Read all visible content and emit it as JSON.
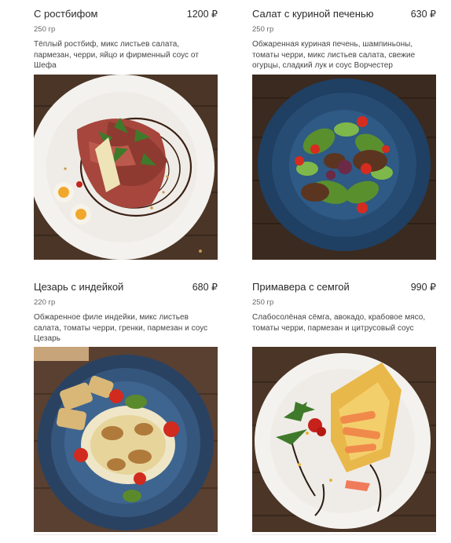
{
  "menu": {
    "items": [
      {
        "title": "С ростбифом",
        "price": "1200 ₽",
        "weight": "250 гр",
        "description": "Тёплый ростбиф, микс листьев салата, пармезан, черри, яйцо и фирменный соус от Шефа",
        "photo": "salad-roastbeef-photo"
      },
      {
        "title": "Салат с куриной печенью",
        "price": "630 ₽",
        "weight": "250 гр",
        "description": "Обжаренная куриная печень, шампиньоны, томаты черри, микс листьев салата, свежие огурцы, сладкий лук и соус Ворчестер",
        "photo": "salad-chicken-liver-photo"
      },
      {
        "title": "Цезарь с индейкой",
        "price": "680 ₽",
        "weight": "220 гр",
        "description": "Обжаренное филе индейки, микс листьев салата, томаты черри, гренки, пармезан и соус Цезарь",
        "photo": "caesar-turkey-photo"
      },
      {
        "title": "Примавера с семгой",
        "price": "990 ₽",
        "weight": "250 гр",
        "description": "Слабосолёная сёмга, авокадо, крабовое мясо, томаты черри, пармезан и цитрусовый соус",
        "photo": "primavera-salmon-photo"
      }
    ]
  },
  "colors": {
    "wood_dark": "#3b2a1f",
    "wood_mid": "#5a4030",
    "plate_white": "#f4f2ee",
    "plate_blue": "#1f3f63",
    "text": "#2a2a2a"
  }
}
